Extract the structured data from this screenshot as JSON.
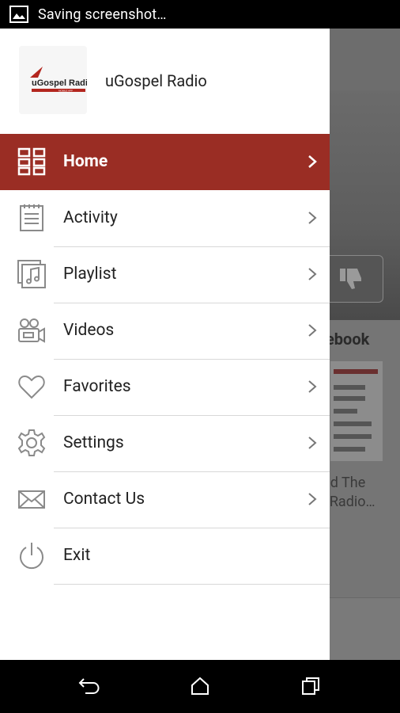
{
  "status_bar": {
    "notification_icon": "image-icon",
    "text": "Saving screenshot…"
  },
  "drawer": {
    "app_name": "uGospel Radio",
    "logo": {
      "text": "uGospel Radio",
      "icon": "ugospel-logo"
    },
    "items": [
      {
        "label": "Home",
        "icon": "grid-icon",
        "active": true,
        "has_chevron": true
      },
      {
        "label": "Activity",
        "icon": "notepad-icon",
        "active": false,
        "has_chevron": true
      },
      {
        "label": "Playlist",
        "icon": "music-note-icon",
        "active": false,
        "has_chevron": true
      },
      {
        "label": "Videos",
        "icon": "video-camera-icon",
        "active": false,
        "has_chevron": true
      },
      {
        "label": "Favorites",
        "icon": "heart-icon",
        "active": false,
        "has_chevron": true
      },
      {
        "label": "Settings",
        "icon": "gear-icon",
        "active": false,
        "has_chevron": true
      },
      {
        "label": "Contact Us",
        "icon": "envelope-icon",
        "active": false,
        "has_chevron": true
      },
      {
        "label": "Exit",
        "icon": "power-icon",
        "active": false,
        "has_chevron": false
      }
    ]
  },
  "background": {
    "facebook_label": "ebook",
    "caption_line1": "ad The",
    "caption_line2": "l Radio…"
  },
  "nav_bar": {
    "back": "back-icon",
    "home": "home-icon",
    "recents": "recents-icon"
  },
  "colors": {
    "accent": "#9a2d24",
    "drawer_bg": "#ffffff",
    "icon_gray": "#8a8a8a"
  }
}
